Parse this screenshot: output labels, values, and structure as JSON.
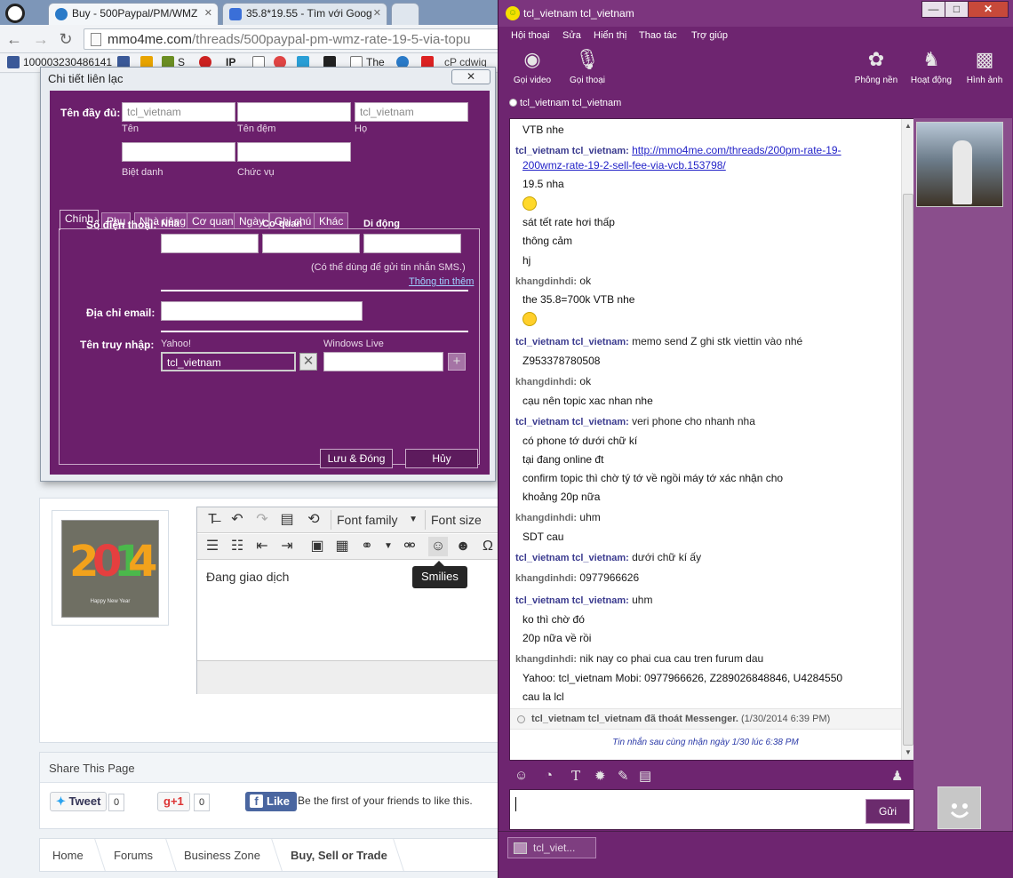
{
  "browser": {
    "tabs": [
      {
        "title": "Buy - 500Paypal/PM/WMZ",
        "icon": "mmo4me-icon"
      },
      {
        "title": "35.8*19.55 - Tìm với Goog",
        "icon": "google-icon"
      }
    ],
    "url_domain": "mmo4me.com",
    "url_path": "/threads/500paypal-pm-wmz-rate-19-5-via-topu",
    "bookmarks": [
      {
        "label": "100003230486141",
        "icon": "facebook-icon",
        "color": "#3b5998"
      },
      {
        "label": "S",
        "icon": "bookmark-icon",
        "color": "#6b8e23"
      },
      {
        "label": "IP",
        "icon": "ip-icon",
        "color": "#888888"
      },
      {
        "label": "The",
        "icon": "page-icon",
        "color": "#333333"
      },
      {
        "label": "cP cdwiq",
        "icon": "cpanel-icon",
        "color": "#ff6c2c"
      }
    ]
  },
  "contact_dialog": {
    "title": "Chi tiết liên lạc",
    "close_label": "✕",
    "full_name_label": "Tên đầy đủ:",
    "first_name": "tcl_vietnam",
    "middle_name": "",
    "last_name": "tcl_vietnam",
    "first_name_caption": "Tên",
    "middle_name_caption": "Tên đệm",
    "last_name_caption": "Họ",
    "nickname_caption": "Biệt danh",
    "position_caption": "Chức vụ",
    "tabs": [
      "Chính",
      "Phụ",
      "Nhà riêng",
      "Cơ quan",
      "Ngày",
      "Ghi chú",
      "Khác"
    ],
    "phone_label": "Số điện thoại:",
    "phone_home": "Nhà",
    "phone_work": "Cơ quan",
    "phone_mobile": "Di động",
    "sms_note": "(Có thể dùng để gửi tin nhắn SMS.)",
    "more_info_link": "Thông tin thêm",
    "email_label": "Địa chỉ email:",
    "login_label": "Tên truy nhập:",
    "yahoo_label": "Yahoo!",
    "yahoo_value": "tcl_vietnam",
    "windows_live_label": "Windows Live",
    "save_label": "Lưu & Đóng",
    "cancel_label": "Hủy"
  },
  "forum": {
    "editor": {
      "font_family": "Font family",
      "font_size": "Font size",
      "content": "Đang giao dịch",
      "tooltip": "Smilies"
    },
    "avatar_text": "2014",
    "avatar_caption": "Happy New Year",
    "share": {
      "title": "Share This Page",
      "tweet": "Tweet",
      "tweet_count": "0",
      "gplus": "+1",
      "gplus_count": "0",
      "like": "Like",
      "like_text": "Be the first of your friends to like this."
    },
    "breadcrumb": [
      "Home",
      "Forums",
      "Business Zone",
      "Buy, Sell or Trade"
    ]
  },
  "messenger": {
    "title": "tcl_vietnam tcl_vietnam",
    "window_buttons": {
      "minimize": "—",
      "maximize": "□",
      "close": "✕"
    },
    "menu": [
      "Hội thoại",
      "Sửa",
      "Hiển thị",
      "Thao tác",
      "Trợ giúp"
    ],
    "toolbar_left": [
      {
        "label": "Gọi video",
        "icon": "webcam-icon"
      },
      {
        "label": "Gọi thoại",
        "icon": "microphone-icon"
      }
    ],
    "toolbar_right": [
      {
        "label": "Phông nền",
        "icon": "flower-icon"
      },
      {
        "label": "Hoạt động",
        "icon": "chess-knight-icon"
      },
      {
        "label": "Hình ảnh",
        "icon": "photos-icon"
      }
    ],
    "contact_name": "tcl_vietnam tcl_vietnam",
    "messages": [
      {
        "sender": "",
        "lines": [
          "VTB nhe"
        ]
      },
      {
        "sender": "tcl_vietnam tcl_vietnam:",
        "text": "http://mmo4me.com/threads/200pm-rate-19-",
        "link": true,
        "lines": [
          "200wmz-rate-19-2-sell-fee-via-vcb.153798/",
          "19.5 nha",
          ":)",
          "sát tết rate hơi thấp",
          "thông cảm",
          "hj"
        ]
      },
      {
        "sender": "khangdinhdi:",
        "text": "ok",
        "lines": [
          "the 35.8=700k VTB nhe",
          ":D"
        ]
      },
      {
        "sender": "tcl_vietnam tcl_vietnam:",
        "text": "memo send Z ghi stk viettin vào nhé",
        "lines": [
          "Z953378780508"
        ]
      },
      {
        "sender": "khangdinhdi:",
        "text": "ok",
        "lines": [
          "cạu nên topic xac nhan nhe"
        ]
      },
      {
        "sender": "tcl_vietnam tcl_vietnam:",
        "text": "veri phone cho nhanh nha",
        "lines": [
          "có phone tớ dưới chữ kí",
          "tại đang online đt",
          "confirm topic thì chờ tý tớ về ngồi máy tớ xác nhận cho",
          "khoảng 20p nữa"
        ]
      },
      {
        "sender": "khangdinhdi:",
        "text": "uhm",
        "lines": [
          "SDT cau"
        ]
      },
      {
        "sender": "tcl_vietnam tcl_vietnam:",
        "text": "dưới chữ kí ấy",
        "lines": []
      },
      {
        "sender": "khangdinhdi:",
        "text": "0977966626",
        "lines": []
      },
      {
        "sender": "tcl_vietnam tcl_vietnam:",
        "text": "uhm",
        "lines": [
          "ko thì chờ đó",
          "20p nữa về rồi"
        ]
      },
      {
        "sender": "khangdinhdi:",
        "text": "nik nay co phai cua cau tren furum dau",
        "lines": [
          "Yahoo: tcl_vietnam Mobi: 0977966626, Z289026848846, U4284550",
          "cau la lcl"
        ]
      }
    ],
    "status_line": "tcl_vietnam tcl_vietnam đã thoát Messenger.",
    "status_time": "(1/30/2014 6:39 PM)",
    "last_received": "Tin nhắn sau cùng nhận ngày 1/30 lúc 6:38 PM",
    "send_label": "Gửi",
    "taskbar_label": "tcl_viet..."
  }
}
